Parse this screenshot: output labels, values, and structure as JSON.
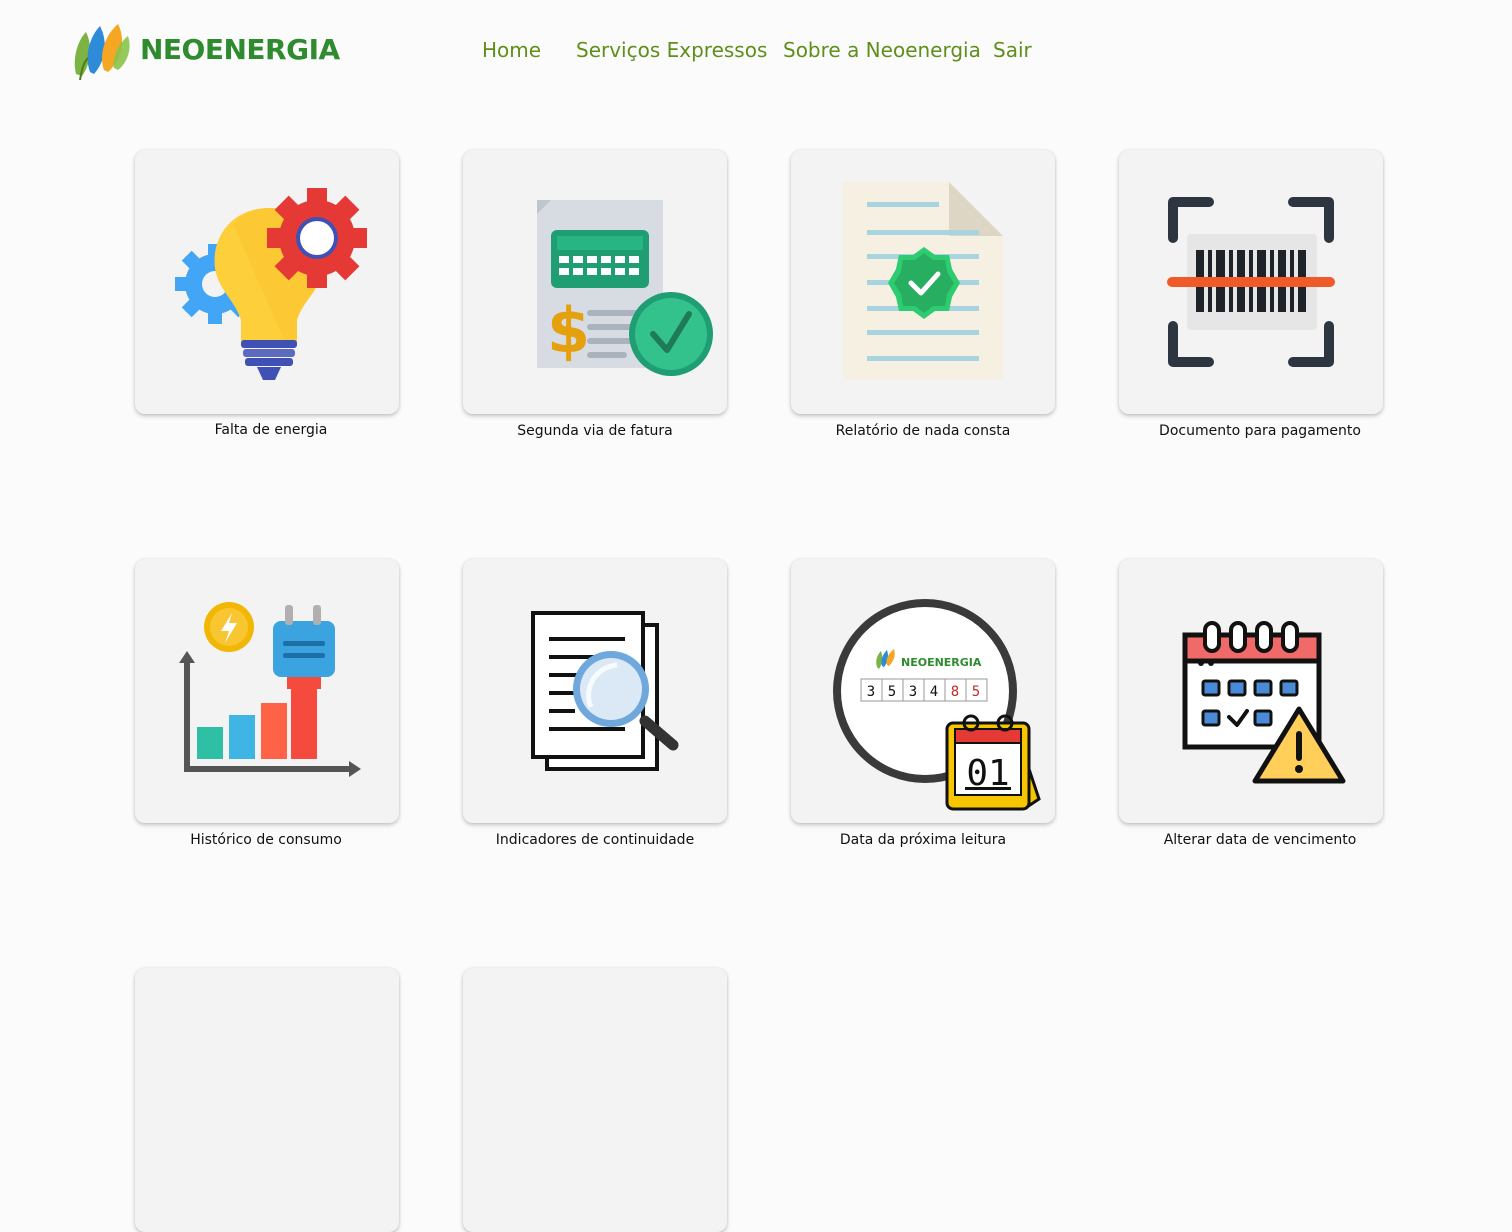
{
  "brand": {
    "name": "NEOENERGIA",
    "color": "#2e8b2e",
    "nav_color": "#5f8f1a"
  },
  "nav": {
    "home": "Home",
    "servicos": "Serviços Expressos",
    "sobre": "Sobre a Neoenergia",
    "sair": "Sair"
  },
  "services": [
    {
      "label": "Falta de energia",
      "icon": "lightbulb-gears-icon"
    },
    {
      "label": "Segunda via de fatura",
      "icon": "invoice-check-icon"
    },
    {
      "label": "Relatório de nada consta",
      "icon": "document-verified-icon"
    },
    {
      "label": "Documento para pagamento",
      "icon": "barcode-scan-icon"
    },
    {
      "label": "Histórico de consumo",
      "icon": "consumption-chart-icon"
    },
    {
      "label": "Indicadores de continuidade",
      "icon": "document-search-icon"
    },
    {
      "label": "Data da próxima leitura",
      "icon": "meter-calendar-icon"
    },
    {
      "label": "Alterar data de vencimento",
      "icon": "calendar-warning-icon"
    }
  ],
  "meter": {
    "brand": "NEOENERGIA",
    "digits": [
      "3",
      "5",
      "3",
      "4",
      "8",
      "5"
    ],
    "calendar_day": "01"
  }
}
